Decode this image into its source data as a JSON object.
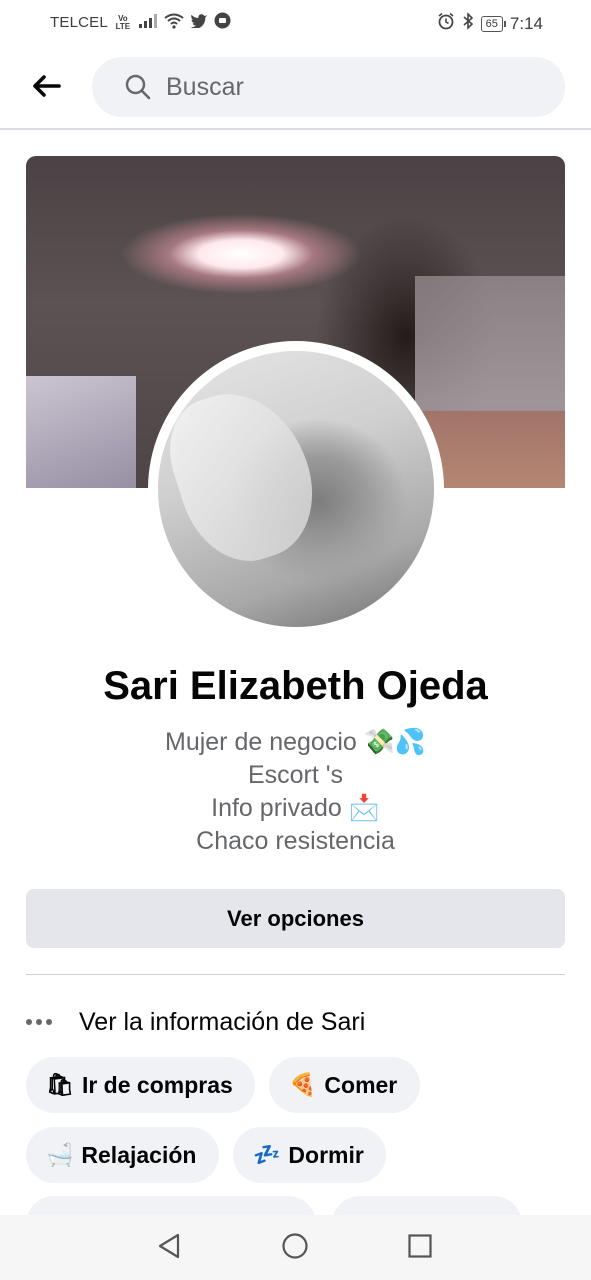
{
  "status_bar": {
    "carrier": "TELCEL",
    "volte": "Vo LTE",
    "battery": "65",
    "time": "7:14"
  },
  "header": {
    "search_placeholder": "Buscar"
  },
  "profile": {
    "name": "Sari Elizabeth Ojeda",
    "bio": [
      "Mujer de negocio 💸💦",
      "Escort 's",
      "Info privado 📩",
      "Chaco resistencia"
    ]
  },
  "actions": {
    "options_label": "Ver opciones",
    "info_label": "Ver la información de Sari"
  },
  "interests": [
    {
      "emoji": "🛍",
      "label": "Ir de compras"
    },
    {
      "emoji": "🍕",
      "label": "Comer"
    },
    {
      "emoji": "🛁",
      "label": "Relajación"
    },
    {
      "emoji": "💤",
      "label": "Dormir"
    }
  ],
  "icons": {
    "back": "arrow-left-icon",
    "search": "search-icon",
    "more": "more-dots-icon",
    "nav_back": "triangle-back-icon",
    "nav_home": "circle-home-icon",
    "nav_recent": "square-recent-icon"
  }
}
